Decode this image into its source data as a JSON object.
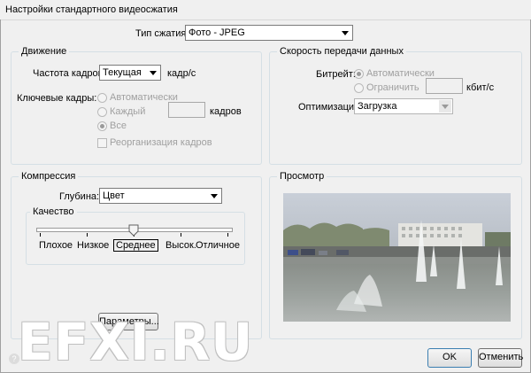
{
  "window": {
    "title": "Настройки стандартного видеосжатия"
  },
  "compression_type": {
    "label": "Тип сжатия:",
    "value": "Фото - JPEG"
  },
  "motion": {
    "group_label": "Движение",
    "frame_rate_label": "Частота кадров:",
    "frame_rate_value": "Текущая",
    "frame_rate_unit": "кадр/с",
    "keyframes_label": "Ключевые кадры:",
    "keyframes_options": [
      "Автоматически",
      "Каждый",
      "Все"
    ],
    "keyframes_unit": "кадров",
    "frame_reorder_label": "Реорганизация кадров"
  },
  "data_rate": {
    "group_label": "Скорость передачи данных",
    "bitrate_label": "Битрейт:",
    "bitrate_options": [
      "Автоматически",
      "Ограничить"
    ],
    "bitrate_unit": "кбит/с",
    "optimize_label": "Оптимизация:",
    "optimize_value": "Загрузка"
  },
  "compression": {
    "group_label": "Компрессия",
    "depth_label": "Глубина:",
    "depth_value": "Цвет",
    "quality_label": "Качество",
    "quality_levels": [
      "Плохое",
      "Низкое",
      "Среднее",
      "Высок.",
      "Отличное"
    ],
    "quality_selected": "Среднее",
    "options_button": "Параметры..."
  },
  "preview": {
    "group_label": "Просмотр"
  },
  "buttons": {
    "ok": "OK",
    "cancel": "Отменить"
  },
  "help_icon": "question-icon",
  "watermark": "EFXI.RU"
}
